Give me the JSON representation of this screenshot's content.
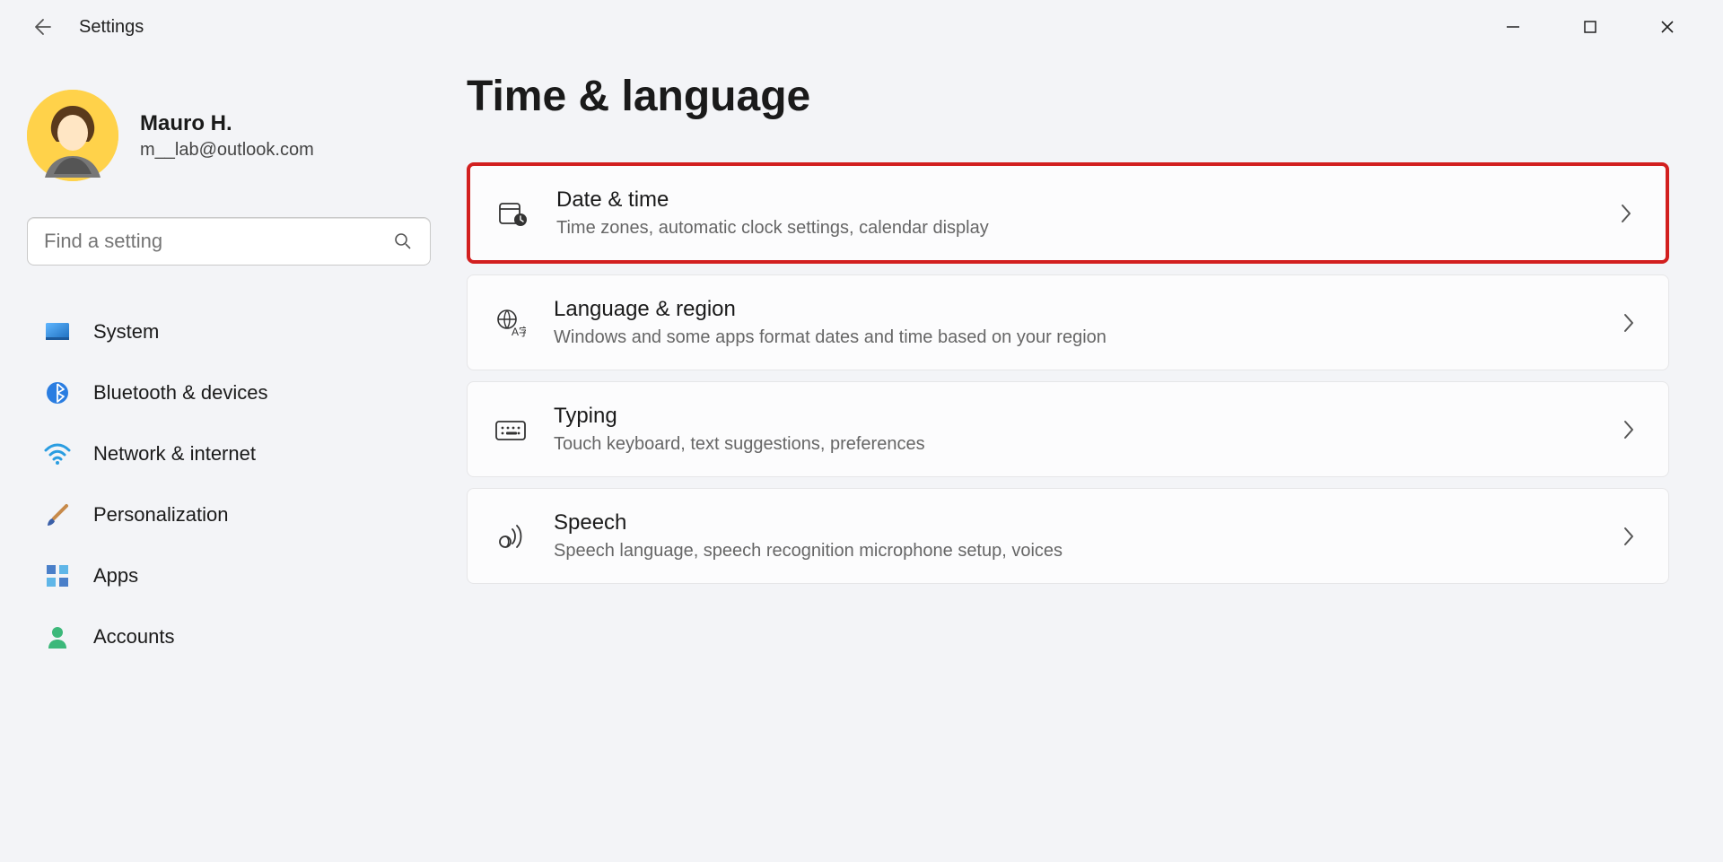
{
  "header": {
    "title": "Settings"
  },
  "user": {
    "name": "Mauro H.",
    "email": "m__lab@outlook.com"
  },
  "search": {
    "placeholder": "Find a setting"
  },
  "sidebar": {
    "items": [
      {
        "label": "System"
      },
      {
        "label": "Bluetooth & devices"
      },
      {
        "label": "Network & internet"
      },
      {
        "label": "Personalization"
      },
      {
        "label": "Apps"
      },
      {
        "label": "Accounts"
      }
    ]
  },
  "main": {
    "title": "Time & language",
    "cards": [
      {
        "title": "Date & time",
        "desc": "Time zones, automatic clock settings, calendar display",
        "highlighted": true
      },
      {
        "title": "Language & region",
        "desc": "Windows and some apps format dates and time based on your region"
      },
      {
        "title": "Typing",
        "desc": "Touch keyboard, text suggestions, preferences"
      },
      {
        "title": "Speech",
        "desc": "Speech language, speech recognition microphone setup, voices"
      }
    ]
  }
}
